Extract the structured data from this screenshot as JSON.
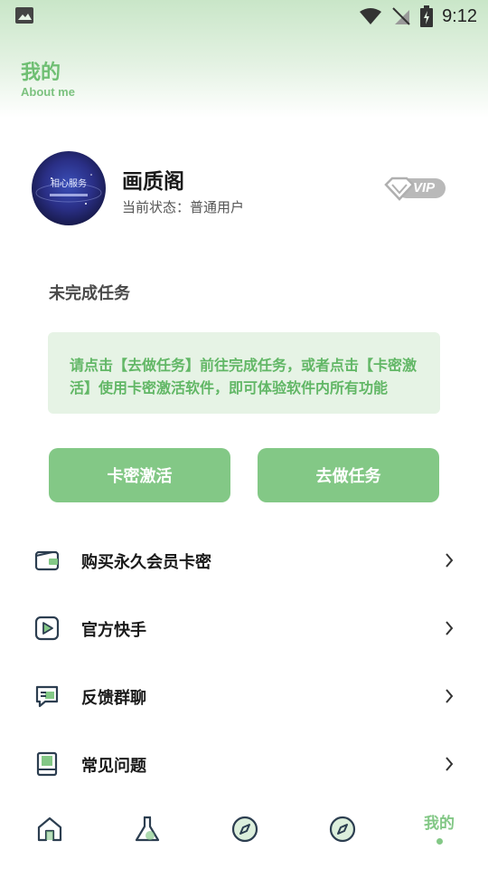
{
  "status_bar": {
    "time": "9:12"
  },
  "header": {
    "title": "我的",
    "subtitle": "About me"
  },
  "profile": {
    "name": "画质阁",
    "status": "当前状态：普通用户",
    "avatar_text": "相心服务",
    "vip_label": "VIP"
  },
  "tasks": {
    "section_title": "未完成任务",
    "notice": "请点击【去做任务】前往完成任务，或者点击【卡密激活】使用卡密激活软件，即可体验软件内所有功能",
    "activate_label": "卡密激活",
    "do_task_label": "去做任务"
  },
  "menu": {
    "items": [
      {
        "label": "购买永久会员卡密",
        "icon": "wallet-icon"
      },
      {
        "label": "官方快手",
        "icon": "video-play-icon"
      },
      {
        "label": "反馈群聊",
        "icon": "chat-icon"
      },
      {
        "label": "常见问题",
        "icon": "book-icon"
      }
    ]
  },
  "tabbar": {
    "active_label": "我的",
    "tabs": [
      {
        "icon": "home-icon"
      },
      {
        "icon": "flask-icon"
      },
      {
        "icon": "compass-icon"
      },
      {
        "icon": "compass-icon"
      },
      {
        "label": "我的"
      }
    ]
  },
  "colors": {
    "accent": "#83c886",
    "accent_text": "#62b766",
    "notice_bg": "#e6f3e5"
  }
}
